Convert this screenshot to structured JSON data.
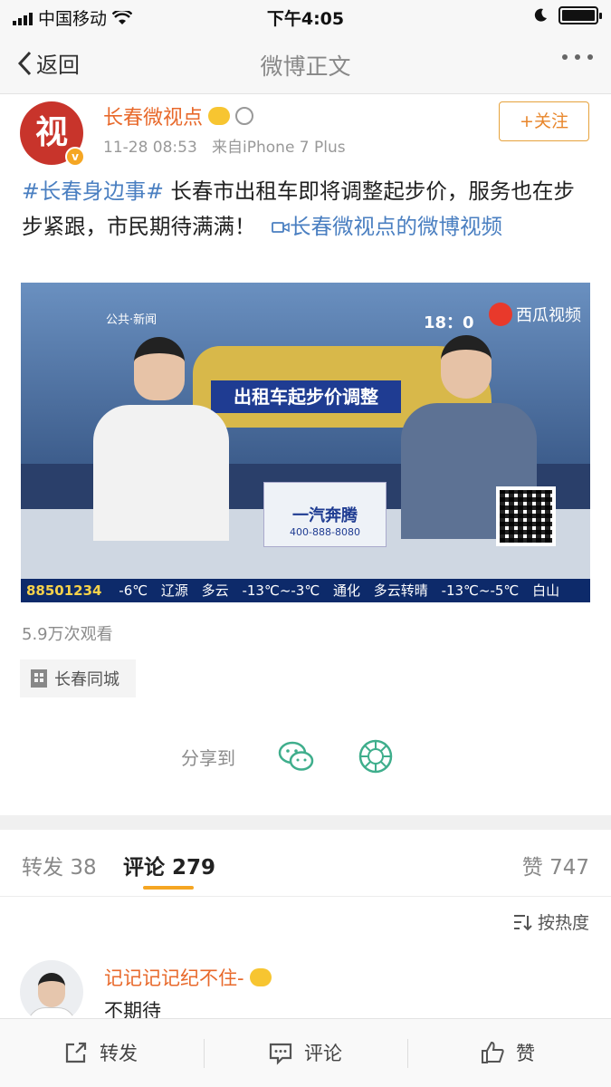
{
  "status_bar": {
    "carrier": "中国移动",
    "time": "下午4:05"
  },
  "nav": {
    "back_label": "返回",
    "title": "微博正文"
  },
  "post": {
    "avatar_text": "视",
    "verified_mark": "v",
    "username": "长春微视点",
    "timestamp": "11-28 08:53",
    "source": "来自iPhone 7 Plus",
    "follow_label": "+关注",
    "hashtag": "#长春身边事#",
    "text": " 长春市出租车即将调整起步价，服务也在步步紧跟，市民期待满满！",
    "video_link": "长春微视点的微博视频",
    "views": "5.9万次观看",
    "location": "长春同城"
  },
  "video": {
    "channel_logo": "公共·新闻",
    "clock": "18：0",
    "watermark": "西瓜视频",
    "headline": "出租车起步价调整",
    "sponsor": "一汽奔腾",
    "sponsor_phone": "400-888-8080",
    "ticker_code": "88501234",
    "ticker_items": [
      "-6℃",
      "辽源",
      "多云",
      "-13℃~-3℃",
      "通化",
      "多云转晴",
      "-13℃~-5℃",
      "白山"
    ]
  },
  "share": {
    "label": "分享到",
    "icons": [
      "wechat-icon",
      "moments-icon"
    ]
  },
  "tabs": [
    {
      "label": "转发",
      "count": "38"
    },
    {
      "label": "评论",
      "count": "279"
    },
    {
      "label": "赞",
      "count": "747"
    }
  ],
  "sort_label": "按热度",
  "comment": {
    "username": "记记记记纪不住-",
    "text": "不期待"
  },
  "toolbar": {
    "repost": "转发",
    "comment": "评论",
    "like": "赞"
  },
  "colors": {
    "accent_orange": "#e8692b",
    "link_blue": "#4a7fc1",
    "tab_underline": "#f5a623"
  }
}
